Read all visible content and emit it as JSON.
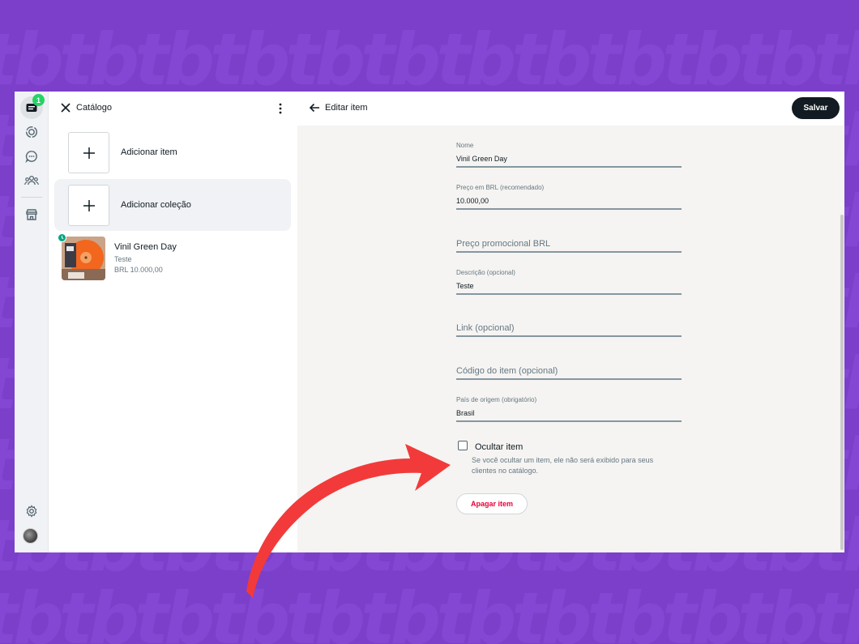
{
  "colors": {
    "background": "#7b3fc9",
    "accent": "#25d366",
    "save_button": "#111b21",
    "delete_text": "#ea0038",
    "annotation_arrow": "#f23a3a"
  },
  "rail": {
    "icons": [
      "store-chat-icon",
      "status-icon",
      "channels-icon",
      "communities-icon",
      "storefront-icon",
      "settings-icon",
      "profile-avatar"
    ],
    "badge_count": "1"
  },
  "catalog": {
    "title": "Catálogo",
    "add_item_label": "Adicionar item",
    "add_collection_label": "Adicionar coleção",
    "items": [
      {
        "name": "Vinil Green Day",
        "description": "Teste",
        "price": "BRL 10.000,00"
      }
    ]
  },
  "edit": {
    "title": "Editar item",
    "save_label": "Salvar",
    "fields": {
      "name": {
        "label": "Nome",
        "value": "Vinil Green Day"
      },
      "price": {
        "label": "Preço em BRL (recomendado)",
        "value": "10.000,00"
      },
      "promo_price": {
        "placeholder": "Preço promocional BRL"
      },
      "description": {
        "label": "Descrição (opcional)",
        "value": "Teste"
      },
      "link": {
        "placeholder": "Link (opcional)"
      },
      "code": {
        "placeholder": "Código do item (opcional)"
      },
      "country": {
        "label": "País de origem (obrigatório)",
        "value": "Brasil"
      }
    },
    "hide_item": {
      "label": "Ocultar item",
      "checked": false,
      "help": "Se você ocultar um item, ele não será exibido para seus clientes no catálogo."
    },
    "delete_label": "Apagar item"
  }
}
